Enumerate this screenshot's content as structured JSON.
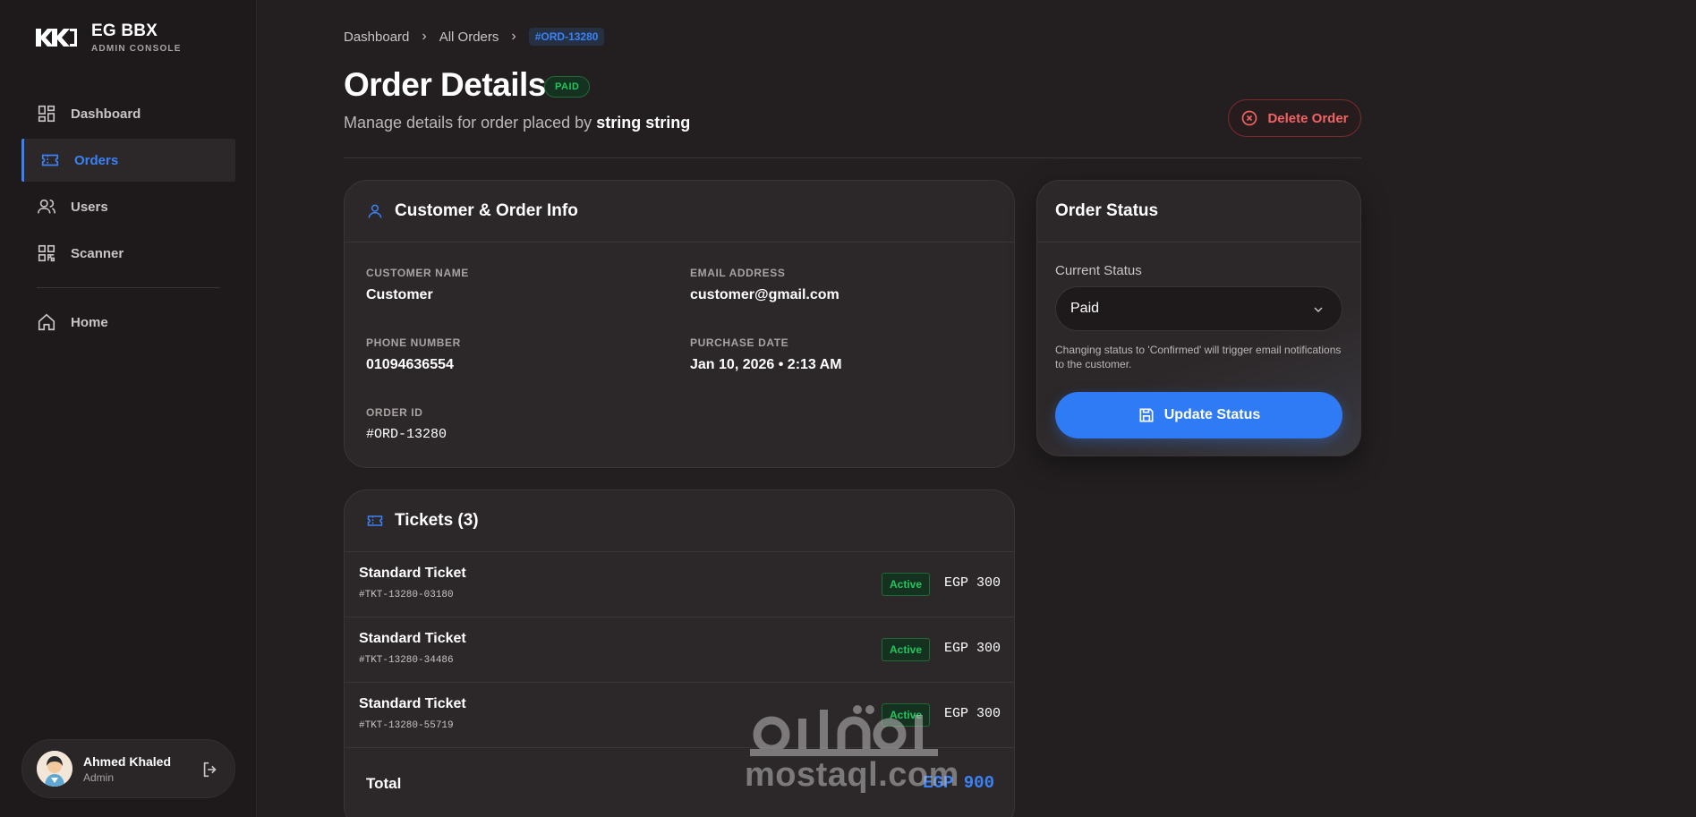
{
  "brand": {
    "title": "EG BBX",
    "subtitle": "ADMIN CONSOLE"
  },
  "sidebar": {
    "items": [
      {
        "label": "Dashboard",
        "icon": "dashboard-icon",
        "active": false
      },
      {
        "label": "Orders",
        "icon": "ticket-icon",
        "active": true
      },
      {
        "label": "Users",
        "icon": "users-icon",
        "active": false
      },
      {
        "label": "Scanner",
        "icon": "qr-icon",
        "active": false
      },
      {
        "label": "Home",
        "icon": "home-icon",
        "active": false
      }
    ]
  },
  "user": {
    "name": "Ahmed Khaled",
    "role": "Admin"
  },
  "breadcrumb": {
    "first": "Dashboard",
    "second": "All Orders",
    "current": "#ORD-13280"
  },
  "header": {
    "title": "Order Details",
    "status_badge": "PAID",
    "subtitle_prefix": "Manage details for order placed by",
    "subtitle_name": "string string",
    "delete_label": "Delete Order"
  },
  "info": {
    "title": "Customer & Order Info",
    "customer_name_label": "CUSTOMER NAME",
    "customer_name": "Customer",
    "email_label": "EMAIL ADDRESS",
    "email": "customer@gmail.com",
    "phone_label": "PHONE NUMBER",
    "phone": "01094636554",
    "purchase_date_label": "PURCHASE DATE",
    "purchase_date": "Jan 10, 2026 • 2:13 AM",
    "order_id_label": "ORDER ID",
    "order_id": "#ORD-13280"
  },
  "tickets": {
    "title": "Tickets (3)",
    "rows": [
      {
        "name": "Standard Ticket",
        "id": "#TKT-13280-03180",
        "status": "Active",
        "price": "EGP 300"
      },
      {
        "name": "Standard Ticket",
        "id": "#TKT-13280-34486",
        "status": "Active",
        "price": "EGP 300"
      },
      {
        "name": "Standard Ticket",
        "id": "#TKT-13280-55719",
        "status": "Active",
        "price": "EGP 300"
      }
    ],
    "total_label": "Total",
    "total_value": "EGP 900"
  },
  "order_status": {
    "title": "Order Status",
    "current_label": "Current Status",
    "selected": "Paid",
    "note": "Changing status to 'Confirmed' will trigger email notifications to the customer.",
    "update_label": "Update Status"
  },
  "watermark": {
    "text": "mostaql.com"
  },
  "colors": {
    "accent": "#3b82f6",
    "success": "#22c55e",
    "danger": "#f26464",
    "background": "#231f20"
  }
}
